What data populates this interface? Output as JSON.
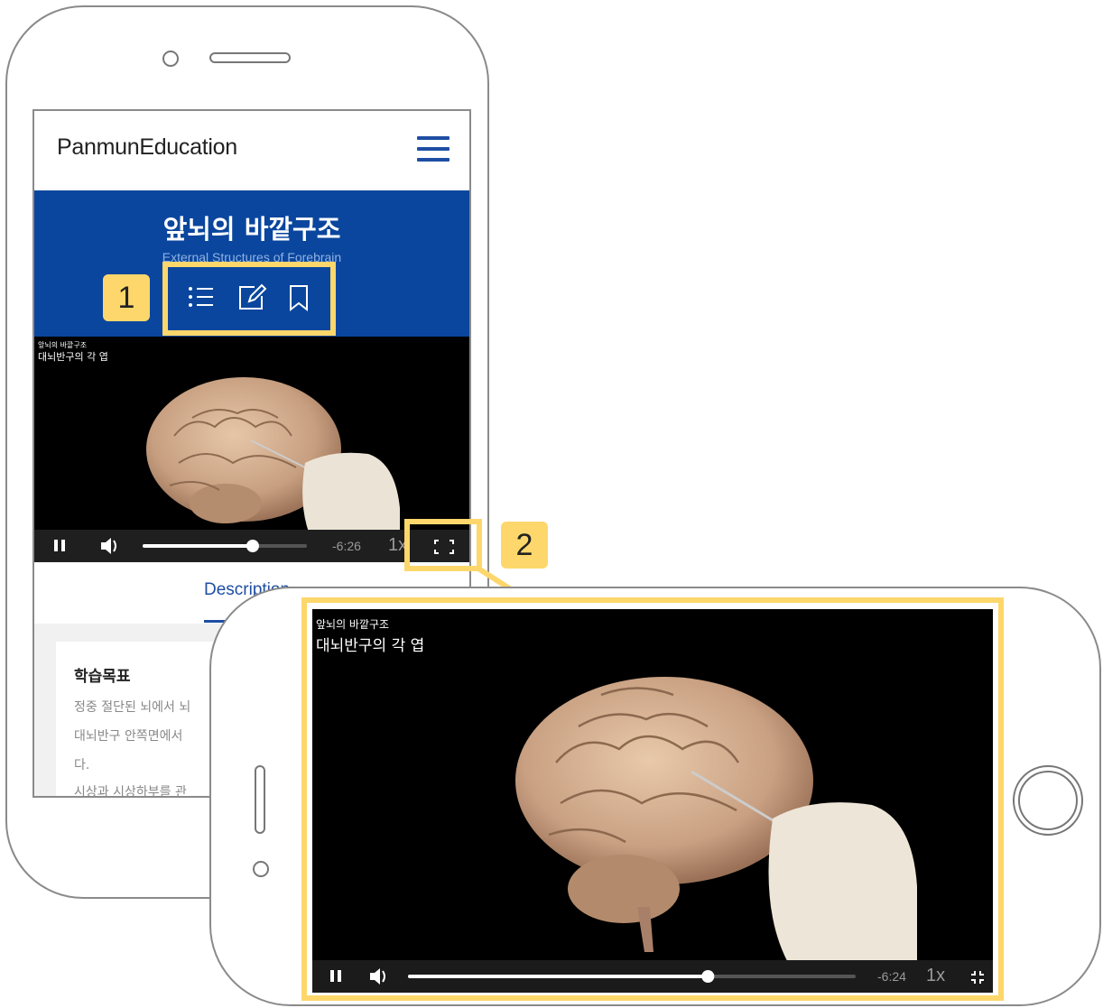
{
  "portrait": {
    "header": {
      "logo": "PanmunEducation",
      "menu_icon": "hamburger-menu-icon"
    },
    "banner": {
      "title": "앞뇌의 바깥구조",
      "subtitle": "External Structures of Forebrain",
      "icons": [
        "list-icon",
        "edit-icon",
        "bookmark-icon"
      ]
    },
    "video": {
      "caption_small": "앞뇌의 바깥구조",
      "caption_big": "대뇌반구의 각 엽",
      "time_remaining": "-6:26",
      "speed": "1x",
      "progress": 0.67
    },
    "tab_label": "Description",
    "card": {
      "title": "학습목표",
      "lines": [
        "정중 절단된 뇌에서 뇌",
        "대뇌반구 안쪽면에서",
        "다.",
        "시상과 시상하부를 관"
      ]
    }
  },
  "landscape": {
    "video": {
      "caption_small": "앞뇌의 바깥구조",
      "caption_big": "대뇌반구의 각 엽",
      "time_remaining": "-6:24",
      "speed": "1x",
      "progress": 0.67
    }
  },
  "callouts": {
    "one": "1",
    "two": "2"
  },
  "colors": {
    "brand_blue": "#0a469d",
    "highlight": "#fdd76b",
    "link_blue": "#1e4ea3"
  }
}
